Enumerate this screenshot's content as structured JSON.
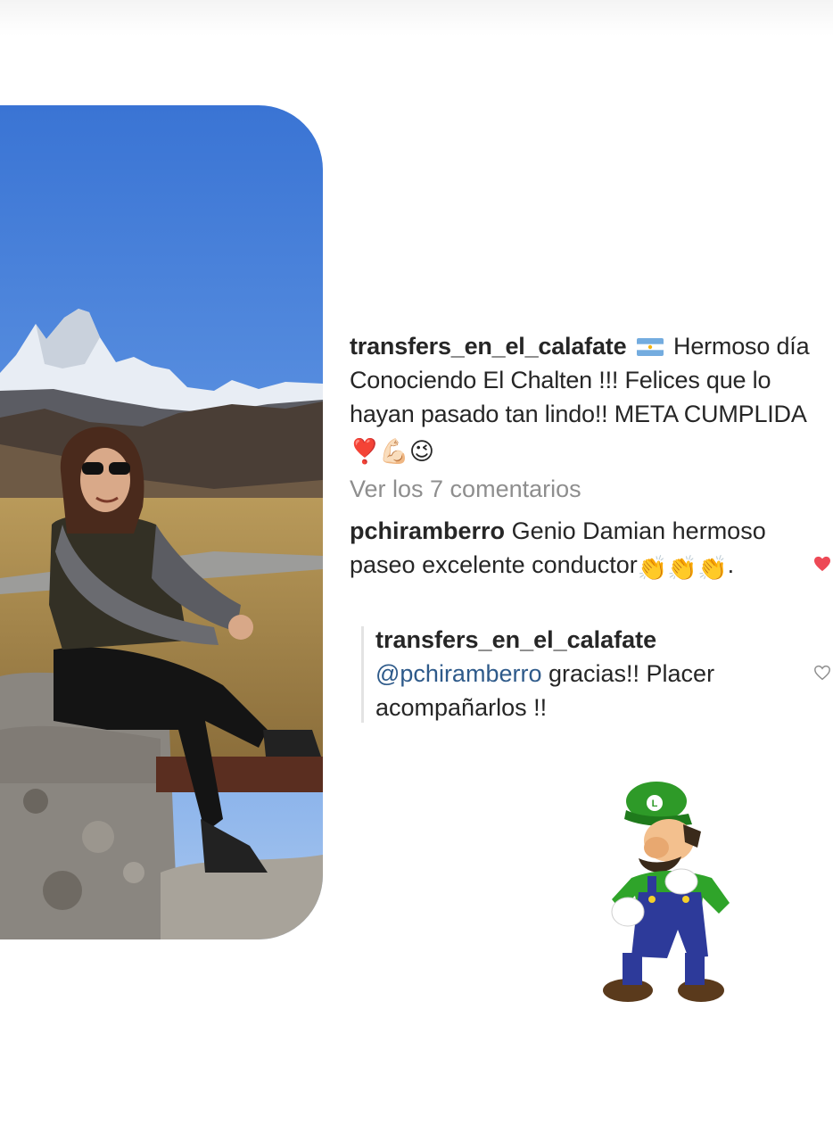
{
  "post": {
    "caption_user": "transfers_en_el_calafate",
    "caption_text": "Hermoso día Conociendo El Chalten !!! Felices que lo hayan pasado tan lindo!! META CUMPLIDA",
    "caption_emojis": "❣️💪🏻😉",
    "view_all_comments": "Ver los 7 comentarios"
  },
  "comment": {
    "user": "pchiramberro",
    "text": "Genio Damian hermoso paseo excelente conductor",
    "emojis": "👏👏👏",
    "trailing": ".",
    "liked": true
  },
  "reply": {
    "user": "transfers_en_el_calafate",
    "mention": "@pchiramberro",
    "text": "gracias!! Placer acompañarlos !!",
    "liked": false
  },
  "icons": {
    "flag": "argentina-flag-icon",
    "like_filled": "heart-filled-icon",
    "like_outline": "heart-outline-icon",
    "sticker": "luigi-sticker"
  },
  "colors": {
    "heart_active": "#ed4956",
    "mention": "#2e5a8a",
    "muted": "#8e8e8e"
  }
}
